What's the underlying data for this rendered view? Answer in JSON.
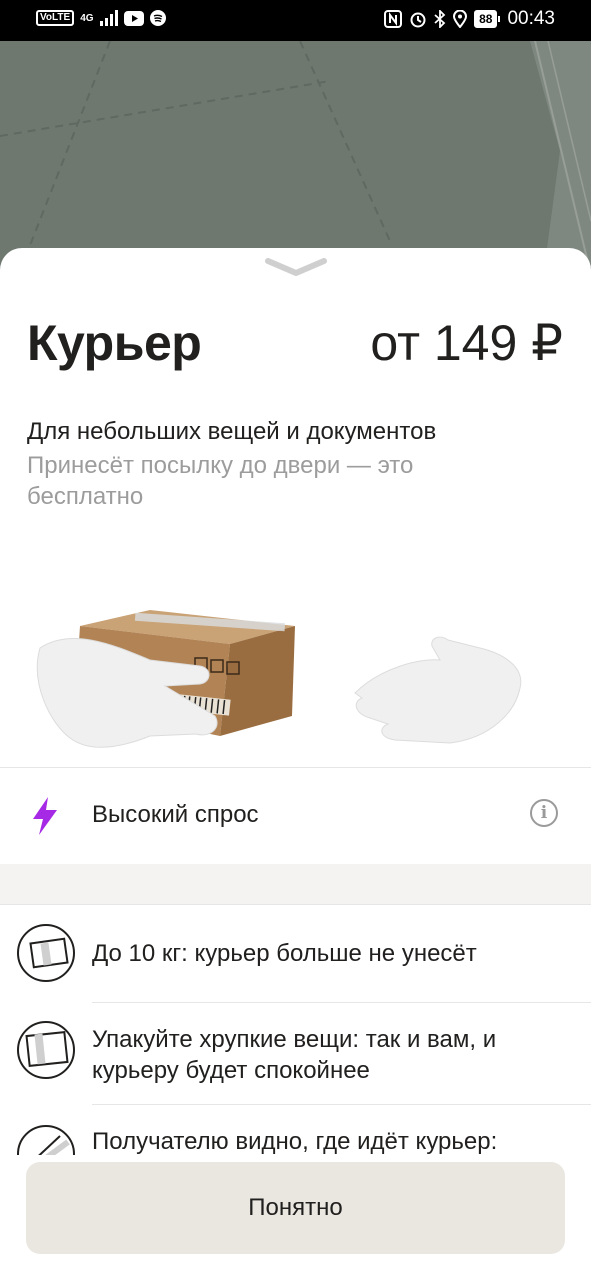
{
  "status_bar": {
    "left_chips": [
      "VoLTE",
      "4G"
    ],
    "battery": "88",
    "time": "00:43",
    "icons": [
      "signal-icon",
      "youtube-icon",
      "spotify-icon",
      "nfc-icon",
      "alarm-icon",
      "bluetooth-icon",
      "location-icon",
      "battery-icon"
    ]
  },
  "carousel": {
    "count": 9,
    "active_index": 7
  },
  "tariff": {
    "title": "Курьер",
    "price": "от 149 ₽",
    "subtitle": "Для небольших вещей и документов",
    "description": "Принесёт посылку до двери — это бесплатно"
  },
  "demand": {
    "label": "Высокий спрос",
    "icon": "lightning-icon",
    "info_icon": "info-icon",
    "accent": "#a629e6"
  },
  "features": [
    {
      "icon": "weight-box-icon",
      "text": "До 10 кг: курьер больше не унесёт"
    },
    {
      "icon": "fragile-box-icon",
      "text": "Упакуйте хрупкие вещи: так и вам, и курьеру будет спокойнее"
    },
    {
      "icon": "courier-tracking-icon",
      "text": "Получателю видно, где идёт курьер:"
    }
  ],
  "button": {
    "label": "Понятно"
  },
  "colors": {
    "map": "#707a72",
    "button_bg": "#eae7e1",
    "muted_text": "#9c9c9c",
    "text": "#21201f"
  }
}
